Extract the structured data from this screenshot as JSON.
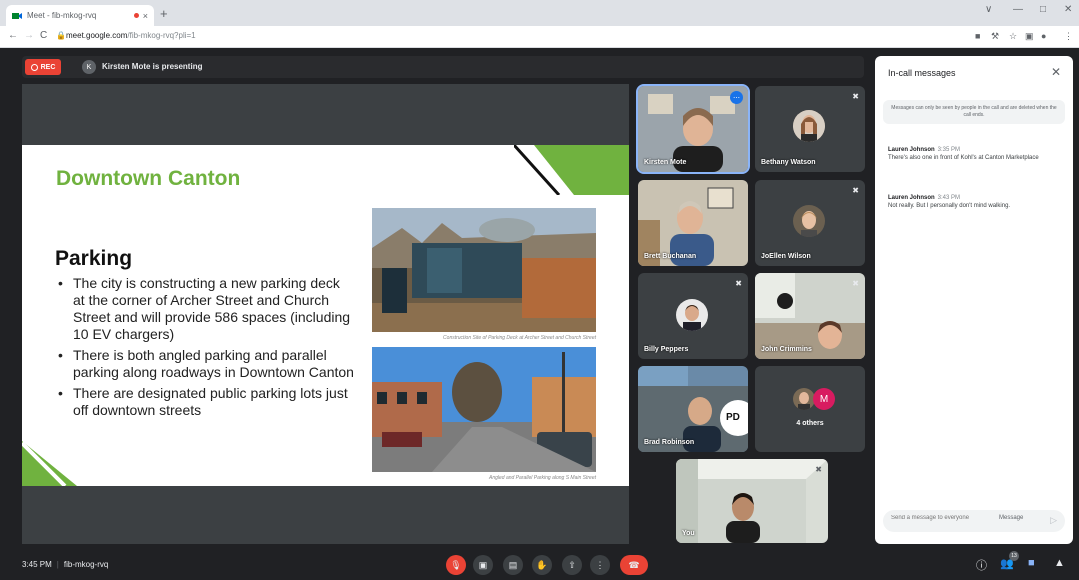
{
  "browser": {
    "tab_title": "Meet - fib-mkog-rvq",
    "tab_close": "×",
    "new_tab": "+",
    "url_host": "meet.google.com",
    "url_path": "/fib-mkog-rvq?pli=1",
    "back": "←",
    "forward": "→",
    "reload": "C",
    "window_controls": [
      "∨",
      "—",
      "□",
      "✕"
    ],
    "ext_icons": [
      "■",
      "⚒",
      "☆",
      "▣",
      "●",
      "⋮"
    ]
  },
  "header": {
    "rec_label": "REC",
    "presenter_initial": "K",
    "presenting_text": "Kirsten Mote is presenting"
  },
  "slide": {
    "title": "Downtown Canton",
    "heading": "Parking",
    "bullets": [
      "The city is constructing a new parking deck at the corner of Archer Street and Church Street and will provide 586 spaces (including 10 EV chargers)",
      "There is both angled parking and parallel parking along roadways in Downtown Canton",
      "There are designated public parking lots just off downtown streets"
    ],
    "caption1": "Construction Site of Parking Deck at Archer Street and Church Street",
    "caption2": "Angled and Parallel Parking along S Main Street",
    "colors": {
      "green": "#70b23f",
      "dark_green": "#3f7d20"
    }
  },
  "tiles": [
    {
      "name": "Kirsten Mote",
      "more": "⋯"
    },
    {
      "name": "Bethany Watson",
      "mute": "🎙"
    },
    {
      "name": "Brett Buchanan"
    },
    {
      "name": "JoEllen Wilson",
      "mute": "🎙"
    },
    {
      "name": "Billy Peppers",
      "mute": "🎙"
    },
    {
      "name": "John Crimmins"
    },
    {
      "name": "Brad Robinson",
      "sign": "PD"
    },
    {
      "name": "4 others",
      "initial": "M"
    },
    {
      "name": "You"
    }
  ],
  "chat": {
    "title": "In-call messages",
    "close": "✕",
    "note": "Messages can only be seen by people in the call and are deleted when the call ends.",
    "messages": [
      {
        "sender": "Lauren Johnson",
        "time": "3:35 PM",
        "text": "There's also one in front of Kohl's at Canton Marketplace"
      },
      {
        "sender": "Lauren Johnson",
        "time": "3:43 PM",
        "text": "Not really. But I personally don't mind walking."
      }
    ],
    "input_placeholder": "Send a message to everyone",
    "input_label": "Message",
    "send": "▷"
  },
  "bottom": {
    "time": "3:45 PM",
    "meeting_code": "fib-mkog-rvq",
    "controls": [
      "🎙",
      "▣",
      "▤",
      "✋",
      "⇧",
      "⋮",
      "☎"
    ],
    "right_icons": [
      "ⓘ",
      "👥",
      "■",
      "▲"
    ],
    "participant_count": "13"
  }
}
